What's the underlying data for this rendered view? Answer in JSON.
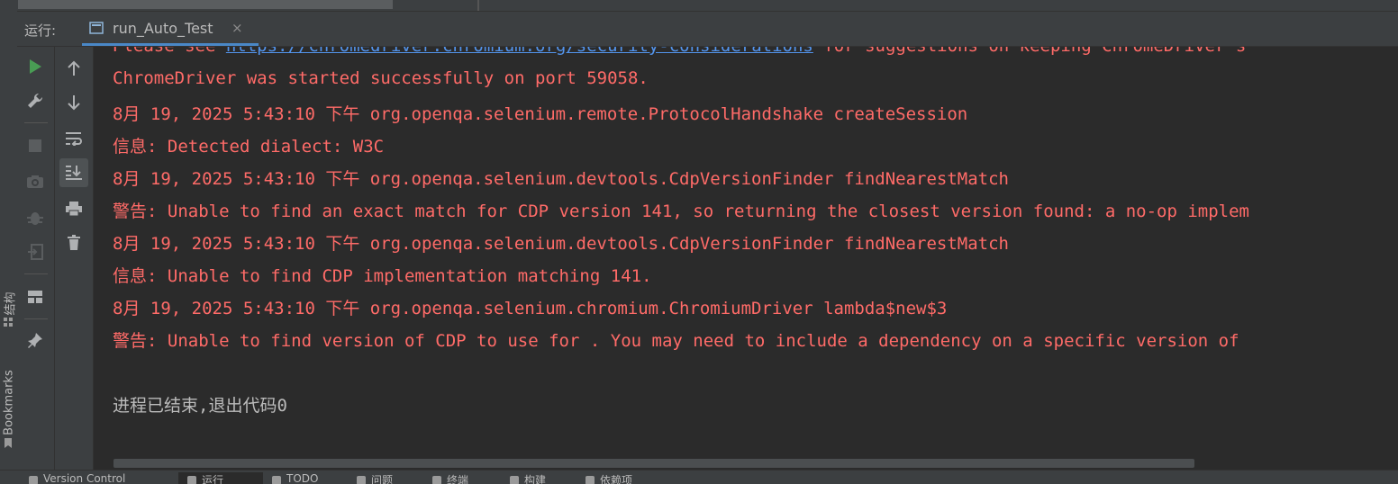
{
  "run_window": {
    "title": "运行:",
    "tab_label": "run_Auto_Test",
    "tab_close": "×"
  },
  "side_stripe": {
    "structure_label": "结构",
    "bookmarks_label": "Bookmarks"
  },
  "console": {
    "lines": [
      {
        "segments": [
          {
            "text": "Please see ",
            "style": "error"
          },
          {
            "text": "https://chromedriver.chromium.org/security-considerations",
            "style": "link"
          },
          {
            "text": " for suggestions on keeping ChromeDriver s",
            "style": "error"
          }
        ]
      },
      {
        "text": "ChromeDriver was started successfully on port 59058."
      },
      {
        "text": "8月 19, 2025 5:43:10 下午 org.openqa.selenium.remote.ProtocolHandshake createSession"
      },
      {
        "text": "信息: Detected dialect: W3C"
      },
      {
        "text": "8月 19, 2025 5:43:10 下午 org.openqa.selenium.devtools.CdpVersionFinder findNearestMatch"
      },
      {
        "text": "警告: Unable to find an exact match for CDP version 141, so returning the closest version found: a no-op implem"
      },
      {
        "text": "8月 19, 2025 5:43:10 下午 org.openqa.selenium.devtools.CdpVersionFinder findNearestMatch"
      },
      {
        "text": "信息: Unable to find CDP implementation matching 141."
      },
      {
        "text": "8月 19, 2025 5:43:10 下午 org.openqa.selenium.chromium.ChromiumDriver lambda$new$3"
      },
      {
        "text": "警告: Unable to find version of CDP to use for . You may need to include a dependency on a specific version of"
      },
      {
        "text": ""
      },
      {
        "text": "进程已结束,退出代码0"
      }
    ]
  },
  "bottom_bar": {
    "items": [
      "Version Control",
      "运行",
      "TODO",
      "问题",
      "终端",
      "构建",
      "依赖项"
    ]
  },
  "colors": {
    "error_text": "#ff6b68",
    "link_text": "#5394ec",
    "plain_text": "#bbbbbb",
    "accent": "#4a88c7",
    "run_green": "#499c54"
  }
}
